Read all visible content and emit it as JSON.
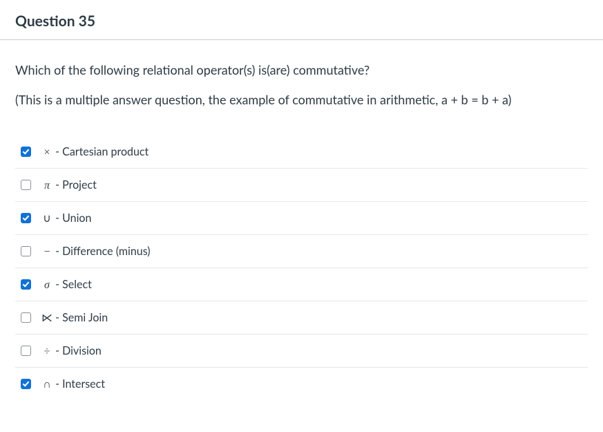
{
  "header": {
    "title": "Question 35"
  },
  "prompt": {
    "line1": "Which of the following relational operator(s) is(are) commutative?",
    "line2": "(This is a multiple answer question,  the example of commutative in arithmetic,  a + b = b + a)"
  },
  "options": [
    {
      "symbol": "×",
      "sym_style": "upright",
      "label": " - Cartesian product",
      "checked": true
    },
    {
      "symbol": "π",
      "sym_style": "italic",
      "label": "  - Project",
      "checked": false
    },
    {
      "symbol": "∪",
      "sym_style": "upright",
      "label": " - Union",
      "checked": true
    },
    {
      "symbol": "−",
      "sym_style": "upright",
      "label": " - Difference (minus)",
      "checked": false
    },
    {
      "symbol": "σ",
      "sym_style": "italic",
      "label": " - Select",
      "checked": true
    },
    {
      "symbol": "⋉",
      "sym_style": "upright",
      "label": "  - Semi Join",
      "checked": false
    },
    {
      "symbol": "÷",
      "sym_style": "upright",
      "label": " - Division",
      "checked": false
    },
    {
      "symbol": "∩",
      "sym_style": "upright",
      "label": " - Intersect",
      "checked": true
    }
  ]
}
